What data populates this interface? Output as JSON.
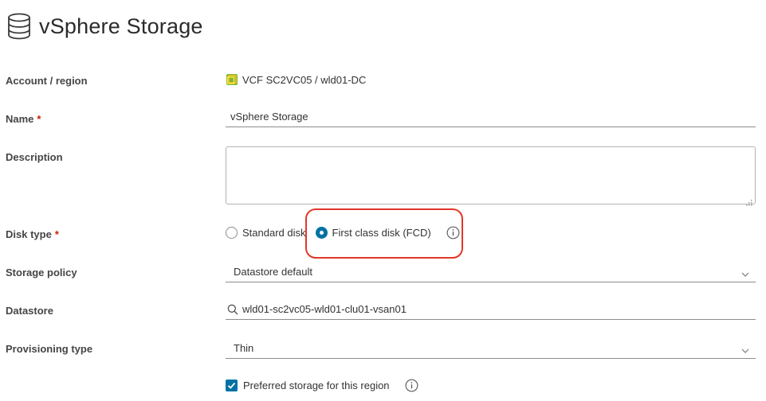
{
  "header": {
    "title": "vSphere Storage",
    "icon": "database-icon"
  },
  "account": {
    "label": "Account / region",
    "value": "VCF SC2VC05 / wld01-DC",
    "icon": "vcenter-icon"
  },
  "name": {
    "label": "Name",
    "required_mark": "*",
    "value": "vSphere Storage"
  },
  "description": {
    "label": "Description",
    "value": ""
  },
  "disk_type": {
    "label": "Disk type",
    "required_mark": "*",
    "options": [
      {
        "label": "Standard disk",
        "checked": false
      },
      {
        "label": "First class disk (FCD)",
        "checked": true
      }
    ],
    "info_icon": "info-icon"
  },
  "storage_policy": {
    "label": "Storage policy",
    "value": "Datastore default"
  },
  "datastore": {
    "label": "Datastore",
    "value": "wld01-sc2vc05-wld01-clu01-vsan01",
    "icon": "search-icon"
  },
  "provisioning": {
    "label": "Provisioning type",
    "value": "Thin"
  },
  "preferred": {
    "label": "Preferred storage for this region",
    "checked": true
  },
  "colors": {
    "accent": "#0072a3",
    "required": "#c92100",
    "highlight": "#e2372a"
  }
}
